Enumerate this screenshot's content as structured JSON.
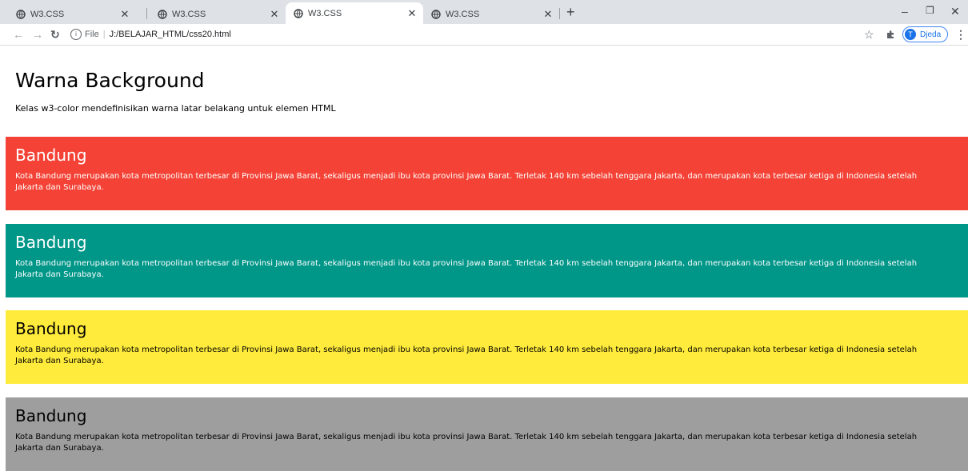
{
  "browser": {
    "tabs": [
      {
        "title": "W3.CSS",
        "active": false
      },
      {
        "title": "W3.CSS",
        "active": false
      },
      {
        "title": "W3.CSS",
        "active": true
      },
      {
        "title": "W3.CSS",
        "active": false
      }
    ],
    "new_tab_label": "+",
    "address": {
      "file_label": "File",
      "url": "J:/BELAJAR_HTML/css20.html"
    },
    "profile": {
      "initial": "T",
      "name": "Djeda"
    }
  },
  "page": {
    "title": "Warna Background",
    "intro": "Kelas w3-color mendefinisikan warna latar belakang untuk elemen HTML",
    "panels": [
      {
        "heading": "Bandung",
        "text": "Kota Bandung merupakan kota metropolitan terbesar di Provinsi Jawa Barat, sekaligus menjadi ibu kota provinsi Jawa Barat. Terletak 140 km sebelah tenggara Jakarta, dan merupakan kota terbesar ketiga di Indonesia setelah Jakarta dan Surabaya.",
        "background": "#f44336",
        "color": "#ffffff"
      },
      {
        "heading": "Bandung",
        "text": "Kota Bandung merupakan kota metropolitan terbesar di Provinsi Jawa Barat, sekaligus menjadi ibu kota provinsi Jawa Barat. Terletak 140 km sebelah tenggara Jakarta, dan merupakan kota terbesar ketiga di Indonesia setelah Jakarta dan Surabaya.",
        "background": "#009688",
        "color": "#ffffff"
      },
      {
        "heading": "Bandung",
        "text": "Kota Bandung merupakan kota metropolitan terbesar di Provinsi Jawa Barat, sekaligus menjadi ibu kota provinsi Jawa Barat. Terletak 140 km sebelah tenggara Jakarta, dan merupakan kota terbesar ketiga di Indonesia setelah Jakarta dan Surabaya.",
        "background": "#ffeb3b",
        "color": "#000000"
      },
      {
        "heading": "Bandung",
        "text": "Kota Bandung merupakan kota metropolitan terbesar di Provinsi Jawa Barat, sekaligus menjadi ibu kota provinsi Jawa Barat. Terletak 140 km sebelah tenggara Jakarta, dan merupakan kota terbesar ketiga di Indonesia setelah Jakarta dan Surabaya.",
        "background": "#9e9e9e",
        "color": "#000000"
      }
    ]
  }
}
